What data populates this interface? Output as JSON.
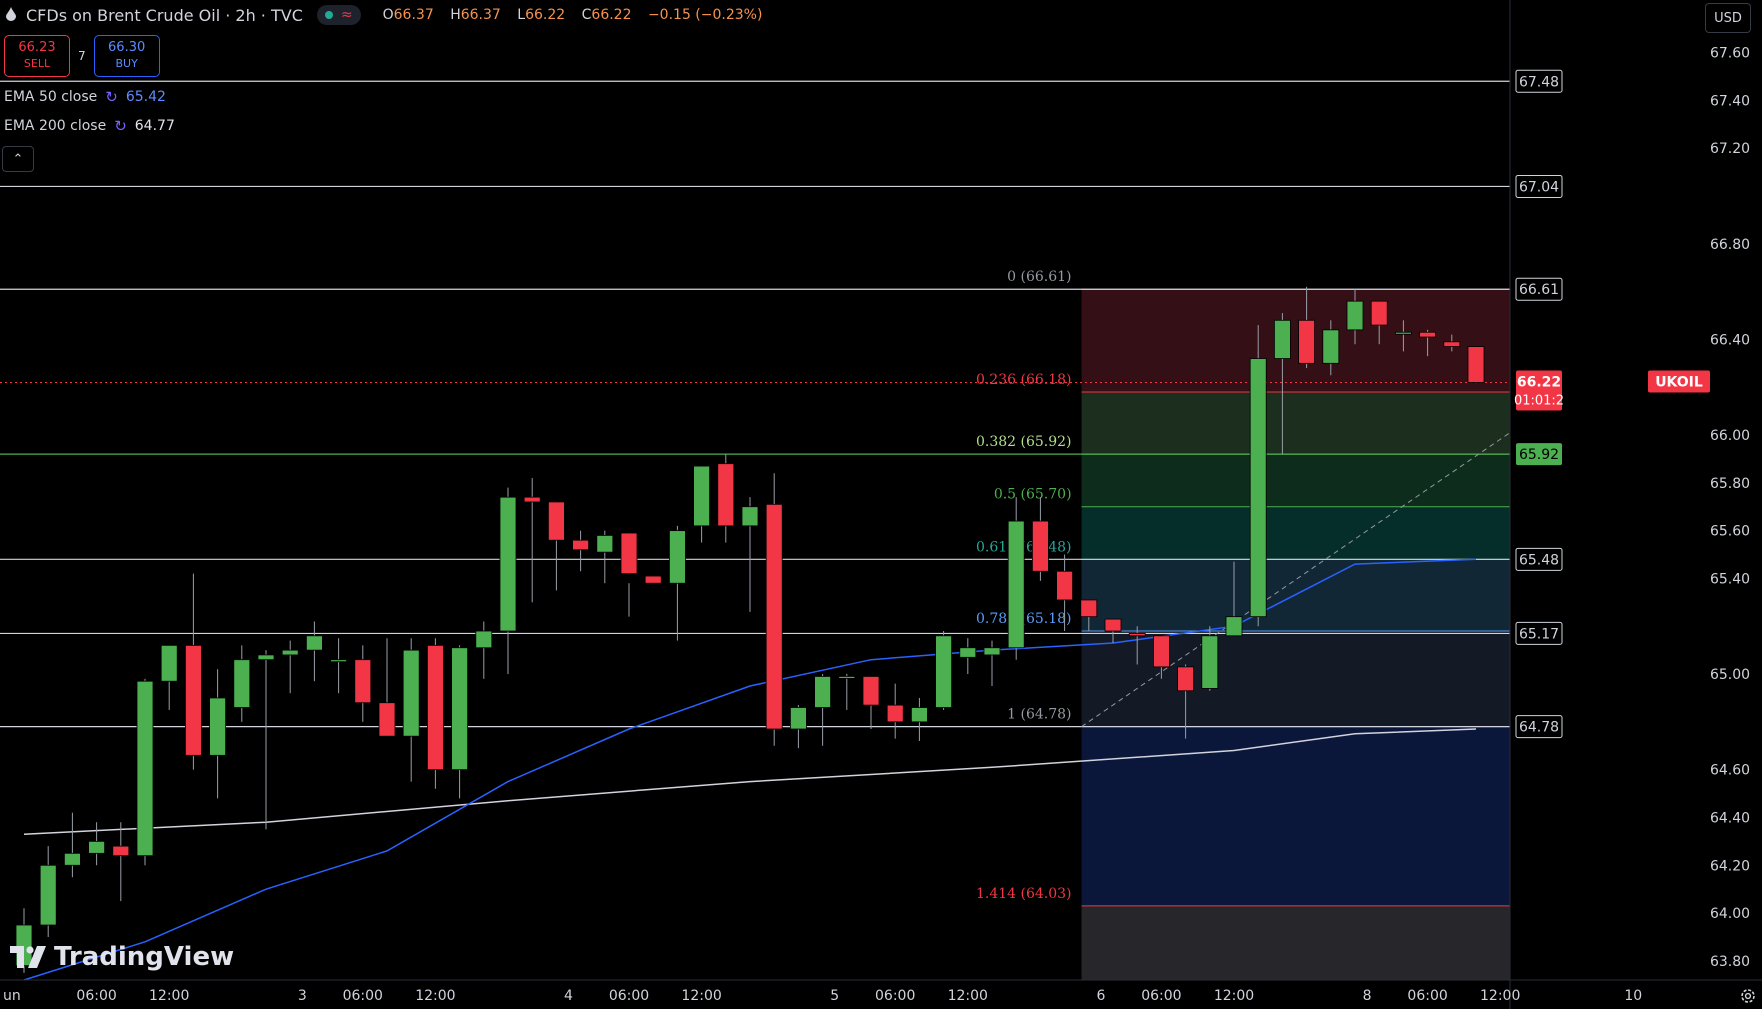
{
  "header": {
    "title": "CFDs on Brent Crude Oil · 2h · TVC",
    "ohlc": {
      "o_label": "O",
      "o": "66.37",
      "h_label": "H",
      "h": "66.37",
      "l_label": "L",
      "l": "66.22",
      "c_label": "C",
      "c": "66.22",
      "change": "−0.15 (−0.23%)"
    }
  },
  "trade": {
    "sell_price": "66.23",
    "sell_label": "SELL",
    "spread": "7",
    "buy_price": "66.30",
    "buy_label": "BUY"
  },
  "indicators": [
    {
      "name": "EMA 50 close",
      "value": "65.42",
      "color": "#2962ff"
    },
    {
      "name": "EMA 200 close",
      "value": "64.77",
      "color": "#e0e3eb"
    }
  ],
  "currency_label": "USD",
  "brand": "TradingView",
  "colors": {
    "up": "#4caf50",
    "down": "#f23645",
    "ema50": "#2962ff",
    "ema200": "#d1d4dc",
    "bg": "#000000"
  },
  "chart_data": {
    "type": "candlestick",
    "symbol": "UKOIL",
    "last_price": "66.22",
    "countdown": "01:01:2",
    "y_ticks": [
      "63.80",
      "64.00",
      "64.20",
      "64.40",
      "64.60",
      "65.00",
      "65.40",
      "65.60",
      "65.80",
      "66.00",
      "66.40",
      "66.80",
      "67.20",
      "67.40",
      "67.60"
    ],
    "ylim": [
      63.72,
      67.82
    ],
    "x_ticks": [
      {
        "label": "un",
        "i": -0.5
      },
      {
        "label": "06:00",
        "i": 3
      },
      {
        "label": "12:00",
        "i": 6
      },
      {
        "label": "3",
        "i": 11.5
      },
      {
        "label": "06:00",
        "i": 14
      },
      {
        "label": "12:00",
        "i": 17
      },
      {
        "label": "4",
        "i": 22.5
      },
      {
        "label": "06:00",
        "i": 25
      },
      {
        "label": "12:00",
        "i": 28
      },
      {
        "label": "5",
        "i": 33.5
      },
      {
        "label": "06:00",
        "i": 36
      },
      {
        "label": "12:00",
        "i": 39
      },
      {
        "label": "6",
        "i": 44.5
      },
      {
        "label": "06:00",
        "i": 47
      },
      {
        "label": "12:00",
        "i": 50
      },
      {
        "label": "8",
        "i": 55.5
      },
      {
        "label": "06:00",
        "i": 58
      },
      {
        "label": "12:00",
        "i": 61
      },
      {
        "label": "10",
        "i": 66.5
      }
    ],
    "candles": [
      [
        63.78,
        64.02,
        63.75,
        63.95
      ],
      [
        63.95,
        64.28,
        63.9,
        64.2
      ],
      [
        64.2,
        64.42,
        64.15,
        64.25
      ],
      [
        64.25,
        64.38,
        64.2,
        64.3
      ],
      [
        64.28,
        64.38,
        64.05,
        64.24
      ],
      [
        64.24,
        64.98,
        64.2,
        64.97
      ],
      [
        64.97,
        65.12,
        64.85,
        65.12
      ],
      [
        65.12,
        65.42,
        64.6,
        64.66
      ],
      [
        64.66,
        65.02,
        64.48,
        64.9
      ],
      [
        64.86,
        65.12,
        64.8,
        65.06
      ],
      [
        65.06,
        65.1,
        64.35,
        65.08
      ],
      [
        65.08,
        65.14,
        64.92,
        65.1
      ],
      [
        65.1,
        65.22,
        64.97,
        65.16
      ],
      [
        65.06,
        65.15,
        64.92,
        65.06
      ],
      [
        65.06,
        65.12,
        64.8,
        64.88
      ],
      [
        64.88,
        65.15,
        64.76,
        64.74
      ],
      [
        64.74,
        65.15,
        64.55,
        65.1
      ],
      [
        65.12,
        65.15,
        64.52,
        64.6
      ],
      [
        64.6,
        65.12,
        64.48,
        65.11
      ],
      [
        65.11,
        65.22,
        64.98,
        65.18
      ],
      [
        65.18,
        65.78,
        65.0,
        65.74
      ],
      [
        65.74,
        65.82,
        65.3,
        65.72
      ],
      [
        65.72,
        65.7,
        65.35,
        65.56
      ],
      [
        65.56,
        65.6,
        65.43,
        65.52
      ],
      [
        65.51,
        65.6,
        65.38,
        65.58
      ],
      [
        65.59,
        65.38,
        65.24,
        65.42
      ],
      [
        65.41,
        65.3,
        65.3,
        65.38
      ],
      [
        65.38,
        65.62,
        65.14,
        65.6
      ],
      [
        65.62,
        65.82,
        65.55,
        65.87
      ],
      [
        65.88,
        65.92,
        65.55,
        65.62
      ],
      [
        65.62,
        65.74,
        65.26,
        65.7
      ],
      [
        65.71,
        65.84,
        64.7,
        64.77
      ],
      [
        64.77,
        64.87,
        64.69,
        64.86
      ],
      [
        64.86,
        65.0,
        64.7,
        64.99
      ],
      [
        64.99,
        65.0,
        64.85,
        64.99
      ],
      [
        64.99,
        64.98,
        64.77,
        64.87
      ],
      [
        64.87,
        64.96,
        64.73,
        64.8
      ],
      [
        64.8,
        64.9,
        64.72,
        64.86
      ],
      [
        64.86,
        65.18,
        64.85,
        65.16
      ],
      [
        65.07,
        65.15,
        65.0,
        65.11
      ],
      [
        65.08,
        65.14,
        64.95,
        65.11
      ],
      [
        65.11,
        65.74,
        65.06,
        65.64
      ],
      [
        65.64,
        65.74,
        65.39,
        65.43
      ],
      [
        65.43,
        65.5,
        65.18,
        65.31
      ],
      [
        65.31,
        65.3,
        65.18,
        65.24
      ],
      [
        65.23,
        65.2,
        65.13,
        65.18
      ],
      [
        65.17,
        65.2,
        65.04,
        65.16
      ],
      [
        65.16,
        65.16,
        64.98,
        65.03
      ],
      [
        65.03,
        65.04,
        64.73,
        64.93
      ],
      [
        64.94,
        65.2,
        64.93,
        65.16
      ],
      [
        65.16,
        65.47,
        65.17,
        65.24
      ],
      [
        65.24,
        66.46,
        65.2,
        66.32
      ],
      [
        66.32,
        66.51,
        65.92,
        66.48
      ],
      [
        66.48,
        66.62,
        66.28,
        66.3
      ],
      [
        66.3,
        66.48,
        66.25,
        66.44
      ],
      [
        66.44,
        66.61,
        66.38,
        66.56
      ],
      [
        66.56,
        66.55,
        66.38,
        66.46
      ],
      [
        66.43,
        66.48,
        66.35,
        66.43
      ],
      [
        66.43,
        66.44,
        66.33,
        66.41
      ],
      [
        66.39,
        66.42,
        66.35,
        66.37
      ],
      [
        66.37,
        66.37,
        66.22,
        66.22
      ]
    ],
    "ema50": [
      [
        0,
        63.72
      ],
      [
        5,
        63.88
      ],
      [
        10,
        64.1
      ],
      [
        15,
        64.26
      ],
      [
        20,
        64.55
      ],
      [
        25,
        64.77
      ],
      [
        30,
        64.95
      ],
      [
        35,
        65.06
      ],
      [
        40,
        65.1
      ],
      [
        45,
        65.13
      ],
      [
        50,
        65.2
      ],
      [
        55,
        65.46
      ],
      [
        60,
        65.48
      ]
    ],
    "ema200": [
      [
        0,
        64.33
      ],
      [
        10,
        64.38
      ],
      [
        20,
        64.47
      ],
      [
        30,
        64.55
      ],
      [
        40,
        64.61
      ],
      [
        50,
        64.68
      ],
      [
        55,
        64.75
      ],
      [
        60,
        64.77
      ]
    ],
    "fibonacci": [
      {
        "label": "0 (66.61)",
        "price": 66.61,
        "color": "#9598a1"
      },
      {
        "label": "0.236 (66.18)",
        "price": 66.18,
        "color": "#f23645"
      },
      {
        "label": "0.382 (65.92)",
        "price": 65.92,
        "color": "#b2df8a"
      },
      {
        "label": "0.5 (65.70)",
        "price": 65.7,
        "color": "#4caf50"
      },
      {
        "label": "0.618 (65.48)",
        "price": 65.48,
        "color": "#26a69a"
      },
      {
        "label": "0.786 (65.18)",
        "price": 65.18,
        "color": "#5b9cf6"
      },
      {
        "label": "1 (64.78)",
        "price": 64.78,
        "color": "#9598a1"
      },
      {
        "label": "1.414 (64.03)",
        "price": 64.03,
        "color": "#f23645"
      }
    ],
    "horizontal_lines": [
      {
        "price": 67.48,
        "label": "67.48",
        "color": "#d1d4dc"
      },
      {
        "price": 67.04,
        "label": "67.04",
        "color": "#d1d4dc"
      },
      {
        "price": 66.61,
        "label": "66.61",
        "color": "#d1d4dc"
      },
      {
        "price": 65.92,
        "label": "65.92",
        "color": "#4caf50"
      },
      {
        "price": 65.48,
        "label": "65.48",
        "color": "#d1d4dc"
      },
      {
        "price": 65.17,
        "label": "65.17",
        "color": "#d1d4dc"
      },
      {
        "price": 64.78,
        "label": "64.78",
        "color": "#d1d4dc"
      }
    ]
  }
}
